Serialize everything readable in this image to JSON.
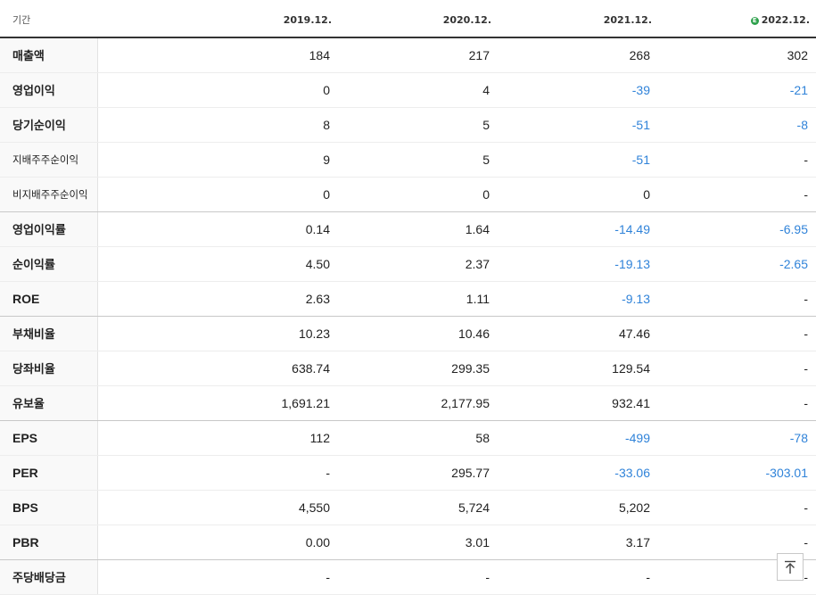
{
  "header": {
    "label": "기간",
    "periods": [
      "2019.12.",
      "2020.12.",
      "2021.12.",
      "2022.12."
    ],
    "estimate_badge": "E"
  },
  "colors": {
    "negative": "#3083d9",
    "estimate_badge": "#2ea14c",
    "header_rule": "#333333"
  },
  "rows": [
    {
      "label": "매출액",
      "values": [
        "184",
        "217",
        "268",
        "302"
      ]
    },
    {
      "label": "영업이익",
      "values": [
        "0",
        "4",
        "-39",
        "-21"
      ]
    },
    {
      "label": "당기순이익",
      "values": [
        "8",
        "5",
        "-51",
        "-8"
      ]
    },
    {
      "label": "지배주주순이익",
      "values": [
        "9",
        "5",
        "-51",
        "-"
      ]
    },
    {
      "label": "비지배주주순이익",
      "values": [
        "0",
        "0",
        "0",
        "-"
      ]
    },
    {
      "label": "영업이익률",
      "values": [
        "0.14",
        "1.64",
        "-14.49",
        "-6.95"
      ]
    },
    {
      "label": "순이익률",
      "values": [
        "4.50",
        "2.37",
        "-19.13",
        "-2.65"
      ]
    },
    {
      "label": "ROE",
      "values": [
        "2.63",
        "1.11",
        "-9.13",
        "-"
      ]
    },
    {
      "label": "부채비율",
      "values": [
        "10.23",
        "10.46",
        "47.46",
        "-"
      ]
    },
    {
      "label": "당좌비율",
      "values": [
        "638.74",
        "299.35",
        "129.54",
        "-"
      ]
    },
    {
      "label": "유보율",
      "values": [
        "1,691.21",
        "2,177.95",
        "932.41",
        "-"
      ]
    },
    {
      "label": "EPS",
      "values": [
        "112",
        "58",
        "-499",
        "-78"
      ]
    },
    {
      "label": "PER",
      "values": [
        "-",
        "295.77",
        "-33.06",
        "-303.01"
      ]
    },
    {
      "label": "BPS",
      "values": [
        "4,550",
        "5,724",
        "5,202",
        "-"
      ]
    },
    {
      "label": "PBR",
      "values": [
        "0.00",
        "3.01",
        "3.17",
        "-"
      ]
    },
    {
      "label": "주당배당금",
      "values": [
        "-",
        "-",
        "-",
        "-"
      ]
    }
  ],
  "scroll_top_icon": "arrow-up-to-line"
}
